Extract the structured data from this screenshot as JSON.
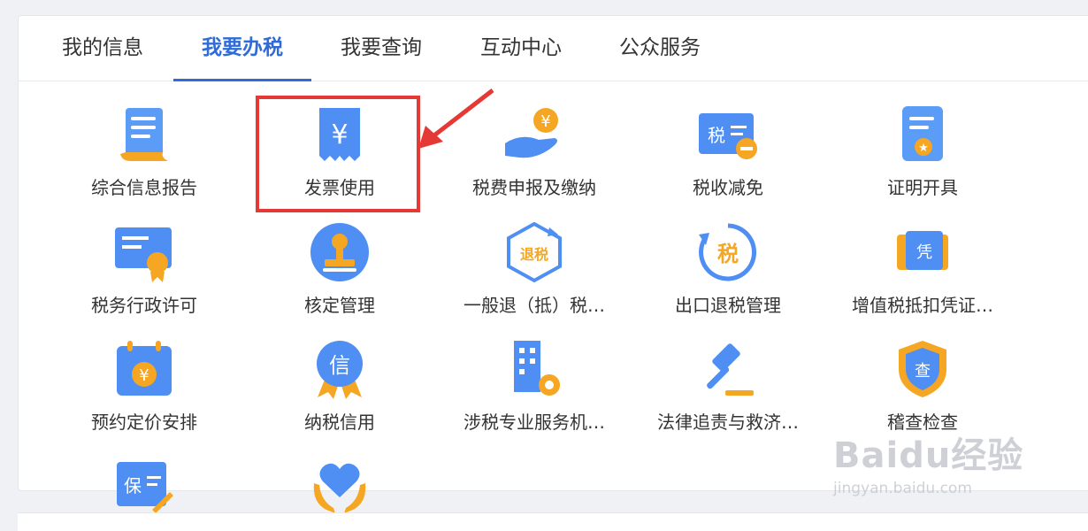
{
  "tabs": [
    {
      "label": "我的信息",
      "active": false
    },
    {
      "label": "我要办税",
      "active": true
    },
    {
      "label": "我要查询",
      "active": false
    },
    {
      "label": "互动中心",
      "active": false
    },
    {
      "label": "公众服务",
      "active": false
    }
  ],
  "items": [
    {
      "label": "综合信息报告",
      "icon": "report-scroll-icon"
    },
    {
      "label": "发票使用",
      "icon": "invoice-yen-icon"
    },
    {
      "label": "税费申报及缴纳",
      "icon": "hand-coin-icon"
    },
    {
      "label": "税收减免",
      "icon": "tax-reduction-icon"
    },
    {
      "label": "证明开具",
      "icon": "certificate-doc-icon"
    },
    {
      "label": "税务行政许可",
      "icon": "license-badge-icon"
    },
    {
      "label": "核定管理",
      "icon": "stamp-icon"
    },
    {
      "label": "一般退（抵）税…",
      "icon": "refund-tax-icon"
    },
    {
      "label": "出口退税管理",
      "icon": "export-refund-icon"
    },
    {
      "label": "增值税抵扣凭证…",
      "icon": "voucher-icon"
    },
    {
      "label": "预约定价安排",
      "icon": "calendar-yen-icon"
    },
    {
      "label": "纳税信用",
      "icon": "credit-medal-icon"
    },
    {
      "label": "涉税专业服务机…",
      "icon": "building-gear-icon"
    },
    {
      "label": "法律追责与救济…",
      "icon": "gavel-icon"
    },
    {
      "label": "稽查检查",
      "icon": "shield-check-icon"
    },
    {
      "label": "",
      "icon": "guarantee-icon"
    },
    {
      "label": "",
      "icon": "heart-hands-icon"
    }
  ],
  "icon_text": {
    "yen": "¥",
    "tax": "税",
    "refund": "退税",
    "voucher": "凭",
    "credit": "信",
    "check": "查",
    "guarantee": "保"
  },
  "watermark": {
    "line1": "Baidu经验",
    "line2": "jingyan.baidu.com"
  },
  "colors": {
    "accent": "#2f6bd9",
    "highlight": "#e53935",
    "orange": "#f5a623",
    "blue": "#3d8ef0"
  }
}
